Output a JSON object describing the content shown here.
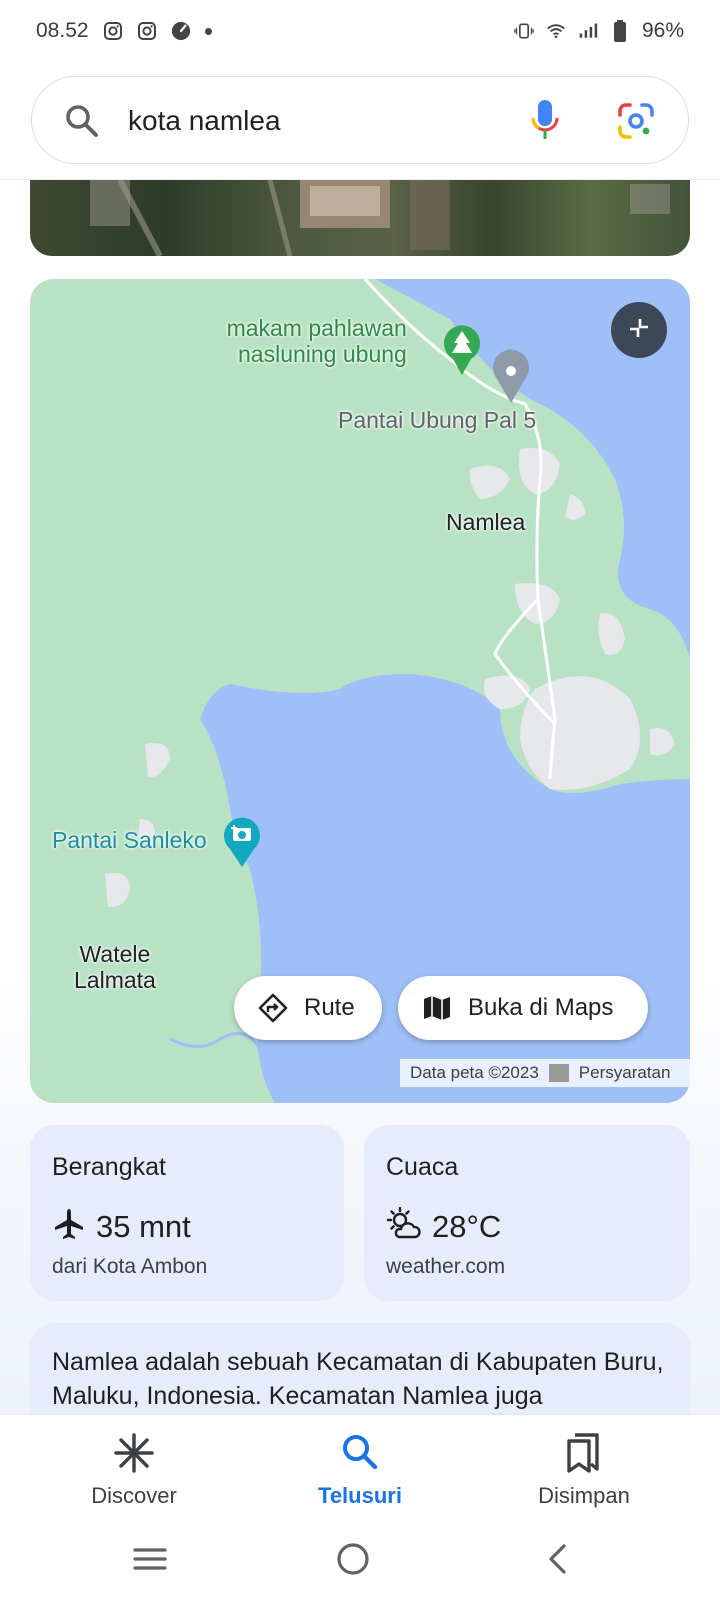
{
  "status_bar": {
    "time": "08.52",
    "battery": "96%",
    "left_icons": [
      "instagram-icon",
      "instagram-icon",
      "speedometer-icon",
      "dot-icon"
    ],
    "right_icons": [
      "vibrate-icon",
      "wifi-icon",
      "signal-icon",
      "battery-icon"
    ]
  },
  "search": {
    "query": "kota namlea",
    "icons": [
      "search-icon",
      "mic-icon",
      "google-lens-icon"
    ]
  },
  "map": {
    "labels": {
      "memorial_line1": "makam pahlawan",
      "memorial_line2": "nasluning ubung",
      "beach_pin": "Pantai Ubung Pal 5",
      "town": "Namlea",
      "beach_photo": "Pantai Sanleko",
      "village_line1": "Watele",
      "village_line2": "Lalmata"
    },
    "route_button": "Rute",
    "open_maps_button": "Buka di Maps",
    "attribution": "Data peta ©2023",
    "terms": "Persyaratan",
    "colors": {
      "land": "#b9e2c4",
      "water": "#9ebff8",
      "urban": "#e8eaed",
      "road": "#ffffff"
    }
  },
  "depart_card": {
    "title": "Berangkat",
    "value": "35 mnt",
    "subtitle": "dari Kota Ambon"
  },
  "weather_card": {
    "title": "Cuaca",
    "value": "28°C",
    "subtitle": "weather.com"
  },
  "description": "Namlea adalah sebuah Kecamatan di Kabupaten Buru, Maluku, Indonesia. Kecamatan Namlea juga",
  "bottom_nav": {
    "items": [
      {
        "label": "Discover",
        "icon": "asterisk-icon",
        "active": false
      },
      {
        "label": "Telusuri",
        "icon": "search-icon",
        "active": true
      },
      {
        "label": "Disimpan",
        "icon": "bookmarks-icon",
        "active": false
      }
    ],
    "active_color": "#1a73e8"
  },
  "system_nav": [
    "recents-button",
    "home-button",
    "back-button"
  ]
}
